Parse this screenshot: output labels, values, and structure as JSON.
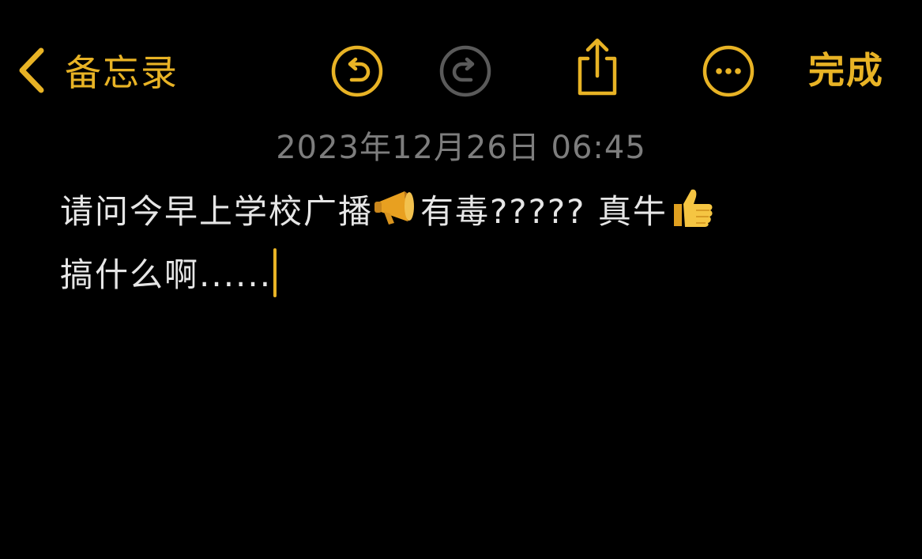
{
  "toolbar": {
    "back_label": "备忘录",
    "done_label": "完成"
  },
  "icons": {
    "back": "chevron-left-icon",
    "undo": "undo-icon",
    "redo": "redo-icon",
    "share": "share-icon",
    "more": "more-icon",
    "megaphone": "megaphone-emoji",
    "thumbs_up": "thumbs-up-emoji"
  },
  "note": {
    "timestamp": "2023年12月26日 06:45",
    "line1_part1": "请问今早上学校广播",
    "line1_part2": "有毒?????  真牛",
    "line2": "搞什么啊......"
  },
  "colors": {
    "accent": "#e8b325",
    "background": "#000000",
    "text": "#e6e6e6",
    "timestamp": "#7d7d7d",
    "disabled_icon": "#5a5a5a"
  }
}
